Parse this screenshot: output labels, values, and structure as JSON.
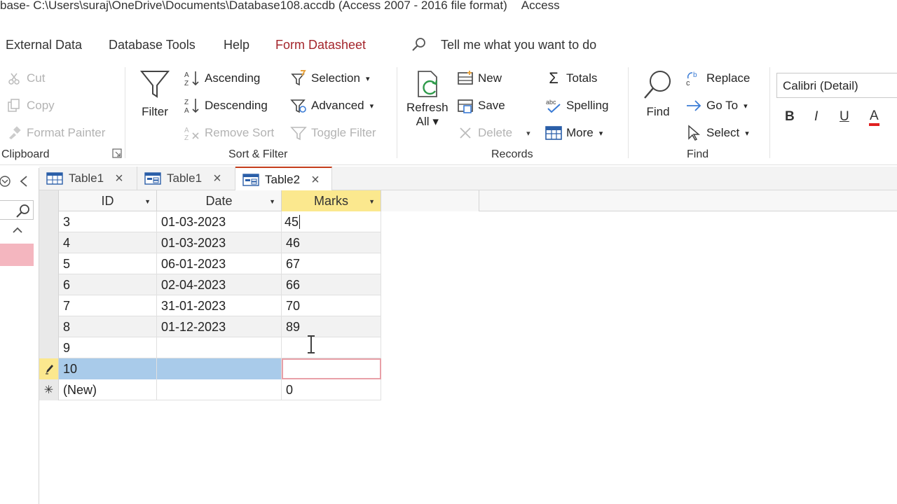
{
  "title": {
    "prefix": "base- C:\\Users\\suraj\\OneDrive\\Documents\\Database108.accdb (Access 2007 - 2016 file format)",
    "app": "Access"
  },
  "menu": {
    "items": [
      "External Data",
      "Database Tools",
      "Help",
      "Form Datasheet"
    ],
    "tell_me": "Tell me what you want to do"
  },
  "ribbon": {
    "clipboard": {
      "cut": "Cut",
      "copy": "Copy",
      "format_painter": "Format Painter",
      "label": "Clipboard"
    },
    "sort_filter": {
      "filter": "Filter",
      "ascending": "Ascending",
      "descending": "Descending",
      "remove_sort": "Remove Sort",
      "selection": "Selection",
      "advanced": "Advanced",
      "toggle_filter": "Toggle Filter",
      "label": "Sort & Filter"
    },
    "records": {
      "refresh_line1": "Refresh",
      "refresh_line2": "All",
      "new": "New",
      "save": "Save",
      "delete": "Delete",
      "totals": "Totals",
      "spelling": "Spelling",
      "more": "More",
      "label": "Records"
    },
    "find": {
      "find": "Find",
      "replace": "Replace",
      "goto": "Go To",
      "select": "Select",
      "label": "Find"
    },
    "text_format": {
      "font": "Calibri (Detail)",
      "bold": "B",
      "italic": "I",
      "underline": "U",
      "font_color": "A"
    }
  },
  "tabs": [
    {
      "label": "Table1"
    },
    {
      "label": "Table1"
    },
    {
      "label": "Table2"
    }
  ],
  "grid": {
    "columns": [
      "ID",
      "Date",
      "Marks"
    ],
    "rows": [
      {
        "id": "3",
        "date": "01-03-2023",
        "marks": "45"
      },
      {
        "id": "4",
        "date": "01-03-2023",
        "marks": "46"
      },
      {
        "id": "5",
        "date": "06-01-2023",
        "marks": "67"
      },
      {
        "id": "6",
        "date": "02-04-2023",
        "marks": "66"
      },
      {
        "id": "7",
        "date": "31-01-2023",
        "marks": "70"
      },
      {
        "id": "8",
        "date": "01-12-2023",
        "marks": "89"
      },
      {
        "id": "9",
        "date": "",
        "marks": ""
      },
      {
        "id": "10",
        "date": "",
        "marks": ""
      }
    ],
    "new_row": {
      "id": "(New)",
      "date": "",
      "marks": "0"
    }
  },
  "colors": {
    "accent": "#a4262c",
    "selected_row": "#a9cbea",
    "header_active": "#fbe88e"
  }
}
